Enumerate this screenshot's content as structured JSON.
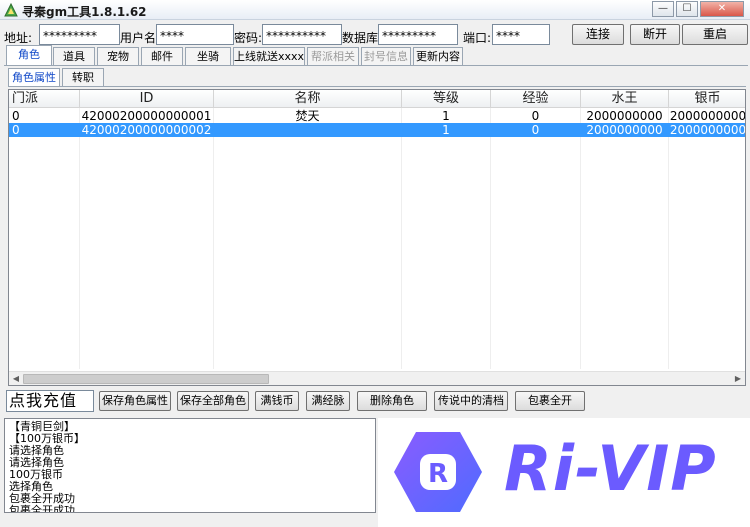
{
  "window": {
    "title": "寻秦gm工具1.8.1.62",
    "min_label": "—",
    "max_label": "☐",
    "close_label": "✕"
  },
  "connection": {
    "address_label": "地址:",
    "address_value": "*********",
    "user_label": "用户名:",
    "user_value": "****",
    "password_label": "密码:",
    "password_value": "**********",
    "database_label": "数据库:",
    "database_value": "*********",
    "port_label": "端口:",
    "port_value": "****",
    "connect_label": "连接",
    "disconnect_label": "断开",
    "restart_label": "重启"
  },
  "tabs": [
    "角色",
    "道具",
    "宠物",
    "邮件",
    "坐骑",
    "上线就送xxxx",
    "帮派相关",
    "封号信息",
    "更新内容"
  ],
  "subtabs": [
    "角色属性",
    "转职"
  ],
  "grid": {
    "columns": [
      "门派",
      "ID",
      "名称",
      "等级",
      "经验",
      "水王",
      "银币"
    ],
    "rows": [
      [
        "0",
        "42000200000000001",
        "焚天",
        "1",
        "0",
        "2000000000",
        "2000000000"
      ],
      [
        "0",
        "42000200000000002",
        "",
        "1",
        "0",
        "2000000000",
        "2000000000"
      ]
    ]
  },
  "actions": {
    "recharge_label": "点我充值",
    "buttons": [
      "保存角色属性",
      "保存全部角色",
      "满钱币",
      "满经脉",
      "删除角色",
      "传说中的清档",
      "包裹全开"
    ]
  },
  "log": [
    "【青铜巨剑】",
    "【100万银币】",
    "请选择角色",
    "请选择角色",
    "100万银币",
    "选择角色",
    "包裹全开成功",
    "包裹全开成功"
  ],
  "logo": {
    "text": "Ri-VIP",
    "badge_letter": "R"
  },
  "colors": {
    "accent": "#1048c8",
    "selection": "#3399ff",
    "brand": "#6b5bff"
  }
}
